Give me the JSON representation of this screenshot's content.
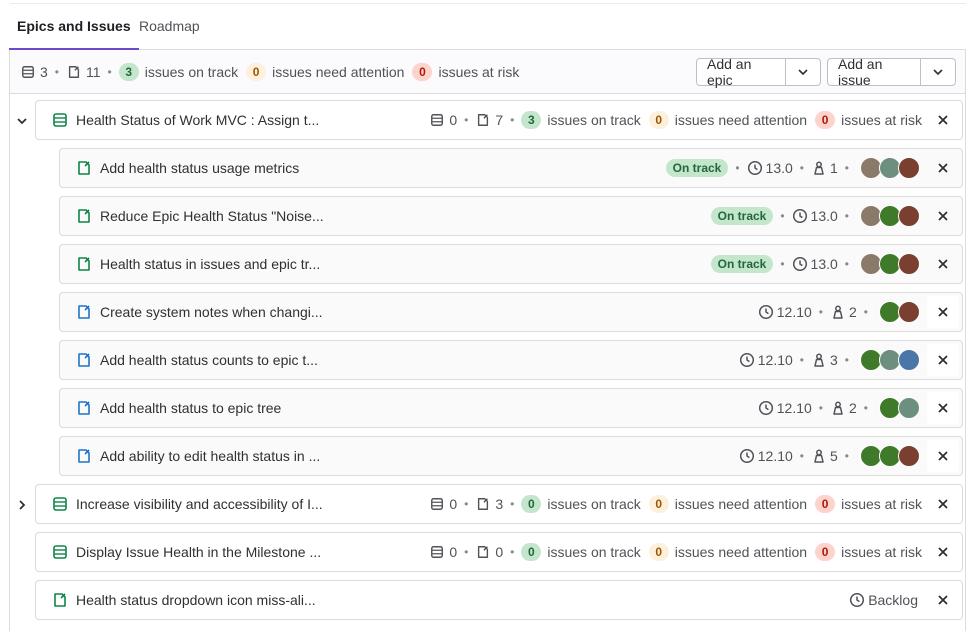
{
  "tabs": [
    {
      "label": "Epics and Issues",
      "active": true
    },
    {
      "label": "Roadmap",
      "active": false
    }
  ],
  "summary": {
    "epics": "3",
    "issues": "11",
    "on_track": "3",
    "on_track_label": "issues on track",
    "attention": "0",
    "attention_label": "issues need attention",
    "risk": "0",
    "risk_label": "issues at risk"
  },
  "buttons": {
    "add_epic": "Add an epic",
    "add_issue": "Add an issue"
  },
  "epics": [
    {
      "title": "Health Status of Work MVC : Assign t...",
      "epics": "0",
      "issues": "7",
      "on_track": "3",
      "attention": "0",
      "risk": "0",
      "on_track_label": "issues on track",
      "attention_label": "issues need attention",
      "risk_label": "issues at risk",
      "expanded": true
    },
    {
      "title": "Increase visibility and accessibility of I...",
      "epics": "0",
      "issues": "3",
      "on_track": "0",
      "attention": "0",
      "risk": "0",
      "on_track_label": "issues on track",
      "attention_label": "issues need attention",
      "risk_label": "issues at risk",
      "expanded": false
    },
    {
      "title": "Display Issue Health in the Milestone ...",
      "epics": "0",
      "issues": "0",
      "on_track": "0",
      "attention": "0",
      "risk": "0",
      "on_track_label": "issues on track",
      "attention_label": "issues need attention",
      "risk_label": "issues at risk"
    }
  ],
  "child_issues": [
    {
      "title": "Add health status usage metrics",
      "status": "On track",
      "milestone": "13.0",
      "weight": "1",
      "state": "open"
    },
    {
      "title": "Reduce Epic Health Status \"Noise...",
      "status": "On track",
      "milestone": "13.0",
      "state": "open"
    },
    {
      "title": "Health status in issues and epic tr...",
      "status": "On track",
      "milestone": "13.0",
      "state": "open"
    },
    {
      "title": "Create system notes when changi...",
      "milestone": "12.10",
      "weight": "2",
      "state": "closed"
    },
    {
      "title": "Add health status counts to epic t...",
      "milestone": "12.10",
      "weight": "3",
      "state": "closed"
    },
    {
      "title": "Add health status to epic tree",
      "milestone": "12.10",
      "weight": "2",
      "state": "closed"
    },
    {
      "title": "Add ability to edit health status in ...",
      "milestone": "12.10",
      "weight": "5",
      "state": "closed"
    }
  ],
  "last_issue": {
    "title": "Health status dropdown icon miss-ali...",
    "milestone": "Backlog"
  },
  "colors": {
    "accent": "#6e49cb",
    "open_issue": "#108548",
    "closed_issue": "#1f75cb",
    "on_track_bg": "#c3e6cd",
    "on_track_text": "#24663b"
  }
}
